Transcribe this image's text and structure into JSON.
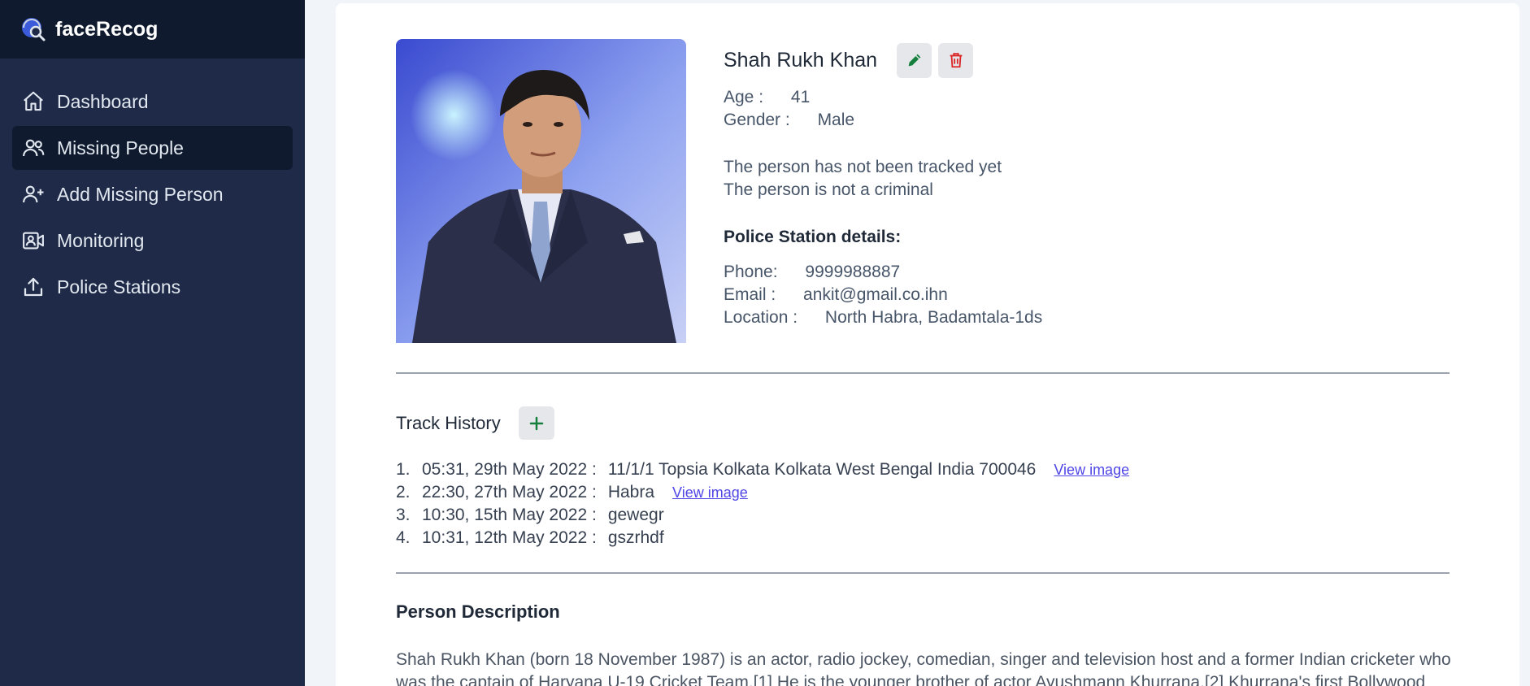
{
  "app": {
    "name": "faceRecog"
  },
  "sidebar": {
    "items": [
      {
        "label": "Dashboard",
        "icon": "home-icon"
      },
      {
        "label": "Missing People",
        "icon": "people-icon",
        "active": true
      },
      {
        "label": "Add Missing Person",
        "icon": "add-user-icon"
      },
      {
        "label": "Monitoring",
        "icon": "camera-user-icon"
      },
      {
        "label": "Police Stations",
        "icon": "upload-icon"
      }
    ]
  },
  "person": {
    "name": "Shah Rukh Khan",
    "age_label": "Age :",
    "age": "41",
    "gender_label": "Gender :",
    "gender": "Male",
    "tracked_status": "The person has not been tracked yet",
    "criminal_status": "The person is not a criminal"
  },
  "police": {
    "title": "Police Station details:",
    "phone_label": "Phone:",
    "phone": "9999988887",
    "email_label": "Email :",
    "email": "ankit@gmail.co.ihn",
    "location_label": "Location :",
    "location": "North Habra, Badamtala-1ds"
  },
  "track": {
    "title": "Track History",
    "view_label": "View image",
    "entries": [
      {
        "num": "1.",
        "time": "05:31, 29th May 2022 :",
        "location": "11/1/1 Topsia Kolkata Kolkata West Bengal India 700046",
        "has_image": true
      },
      {
        "num": "2.",
        "time": "22:30, 27th May 2022 :",
        "location": "Habra",
        "has_image": true
      },
      {
        "num": "3.",
        "time": "10:30, 15th May 2022 :",
        "location": "gewegr",
        "has_image": false
      },
      {
        "num": "4.",
        "time": "10:31, 12th May 2022 :",
        "location": "gszrhdf",
        "has_image": false
      }
    ]
  },
  "description": {
    "title": "Person Description",
    "text": "Shah Rukh Khan (born 18 November 1987) is an actor, radio jockey, comedian, singer and television host and a former Indian cricketer who was the captain of Haryana U-19 Cricket Team.[1] He is the younger brother of actor Ayushmann Khurrana.[2] Khurrana's first Bollywood"
  },
  "colors": {
    "sidebar_bg": "#1e2a47",
    "brand_bg": "#0f1a2e",
    "edit_icon": "#15803d",
    "delete_icon": "#dc2626",
    "link": "#4f46e5"
  }
}
